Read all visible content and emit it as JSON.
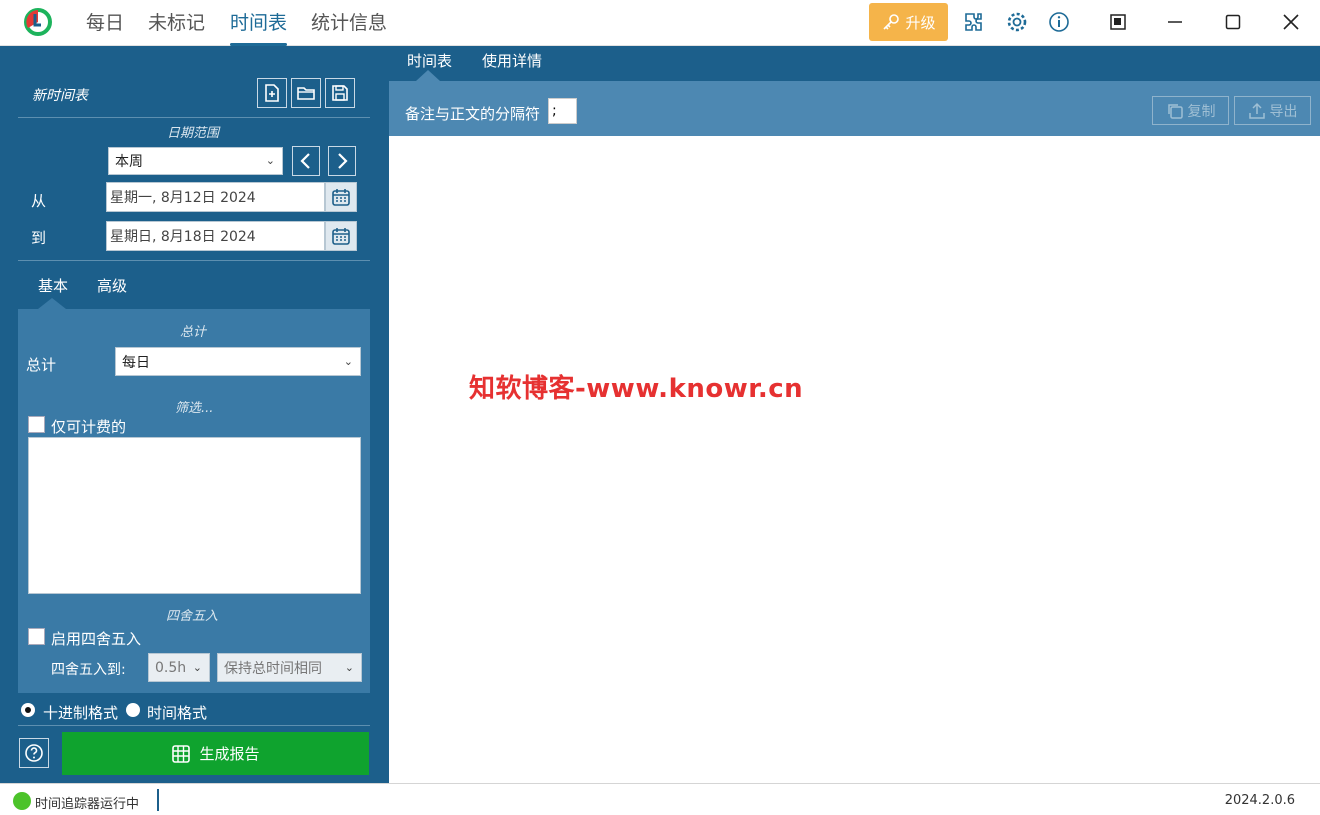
{
  "nav": {
    "tabs": [
      "每日",
      "未标记",
      "时间表",
      "统计信息"
    ],
    "active_tab": "时间表",
    "upgrade_label": "升级"
  },
  "timesheet_panel": {
    "title": "新时间表",
    "date_range_label": "日期范围",
    "period_value": "本周",
    "from_label": "从",
    "to_label": "到",
    "from_date": "星期一, 8月12日 2024",
    "to_date": "星期日, 8月18日 2024",
    "subtabs": [
      "基本",
      "高级"
    ],
    "total_section_label": "总计",
    "total_label": "总计",
    "total_value": "每日",
    "filter_section_label": "筛选...",
    "billable_only_label": "仅可计费的",
    "rounding_section_label": "四舍五入",
    "enable_rounding_label": "启用四舍五入",
    "round_to_label": "四舍五入到:",
    "round_to_value": "0.5h",
    "round_mode_value": "保持总时间相同",
    "format_decimal_label": "十进制格式",
    "format_time_label": "时间格式",
    "generate_label": "生成报告"
  },
  "content": {
    "tabs": [
      "时间表",
      "使用详情"
    ],
    "separator_label": "备注与正文的分隔符",
    "separator_value": ";",
    "copy_label": "复制",
    "export_label": "导出",
    "watermark": "知软博客-www.knowr.cn"
  },
  "status": {
    "tracker_text": "时间追踪器运行中",
    "version": "2024.2.0.6"
  },
  "colors": {
    "nav_active": "#1e6b97",
    "upgrade": "#f5b44a",
    "panel": "#1c5f8b",
    "panel_light": "#3a7aa6",
    "toolbar": "#4d88b2",
    "generate": "#0fa32e",
    "watermark": "#e63131",
    "status_ok": "#4cc32a"
  }
}
